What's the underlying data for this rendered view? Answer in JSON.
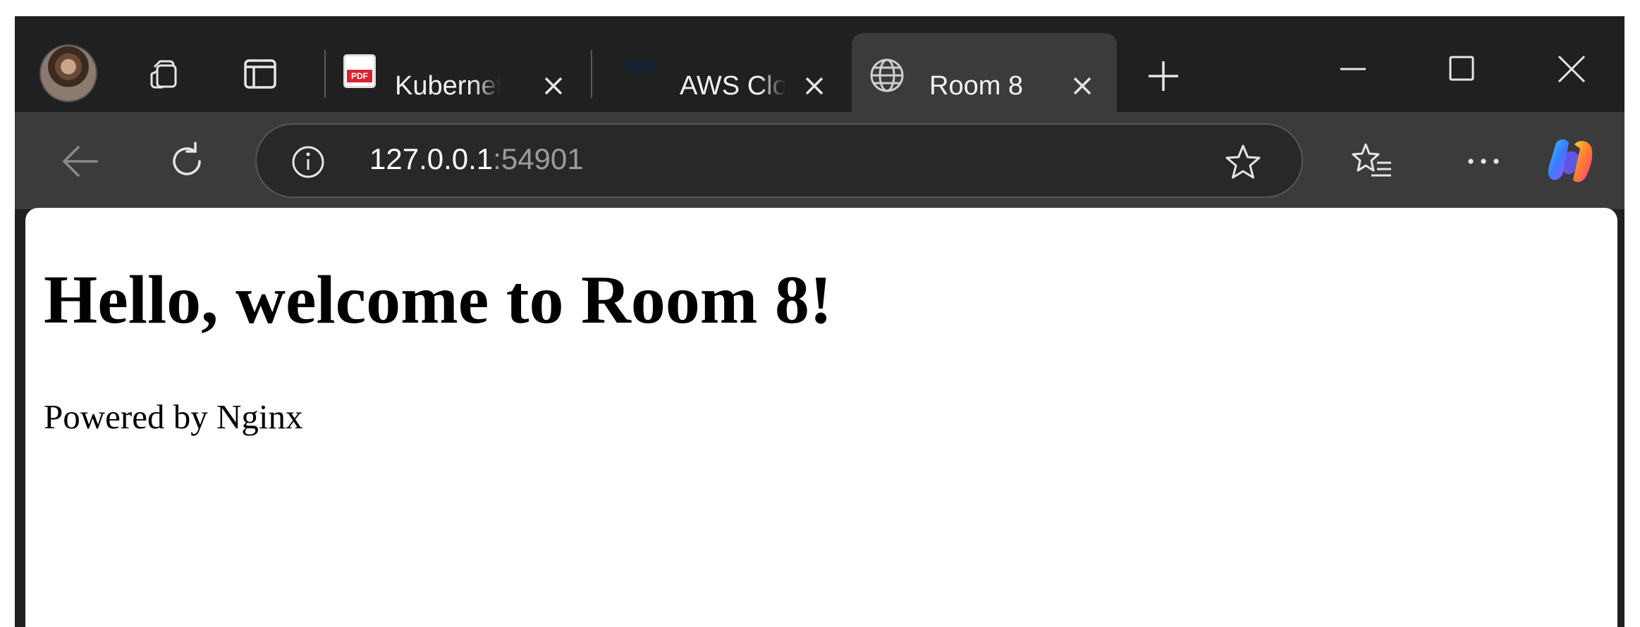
{
  "browser": {
    "tabs": [
      {
        "label": "Kubernetes",
        "icon": "pdf-icon",
        "badge": "PDF",
        "active": false
      },
      {
        "label": "AWS Cloud",
        "icon": "aws-icon",
        "active": false
      },
      {
        "label": "Room 8",
        "icon": "globe-icon",
        "active": true
      }
    ],
    "address": {
      "host": "127.0.0.1",
      "port": ":54901"
    }
  },
  "page": {
    "heading": "Hello, welcome to Room 8!",
    "footer_text": "Powered by Nginx"
  },
  "colors": {
    "chrome_dark": "#202020",
    "chrome_toolbar": "#3b3b3b",
    "pdf_red": "#d9232e"
  }
}
